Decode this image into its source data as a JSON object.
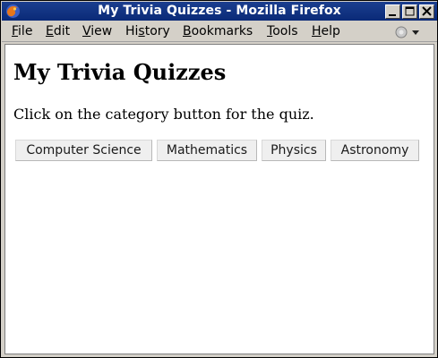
{
  "window": {
    "title": "My Trivia Quizzes - Mozilla Firefox"
  },
  "menubar": {
    "items": [
      {
        "label_pre": "",
        "label_u": "F",
        "label_post": "ile"
      },
      {
        "label_pre": "",
        "label_u": "E",
        "label_post": "dit"
      },
      {
        "label_pre": "",
        "label_u": "V",
        "label_post": "iew"
      },
      {
        "label_pre": "Hi",
        "label_u": "s",
        "label_post": "tory"
      },
      {
        "label_pre": "",
        "label_u": "B",
        "label_post": "ookmarks"
      },
      {
        "label_pre": "",
        "label_u": "T",
        "label_post": "ools"
      },
      {
        "label_pre": "",
        "label_u": "H",
        "label_post": "elp"
      }
    ]
  },
  "page": {
    "heading": "My Trivia Quizzes",
    "description": "Click on the category button for the quiz.",
    "categories": [
      {
        "label": "Computer Science"
      },
      {
        "label": "Mathematics"
      },
      {
        "label": "Physics"
      },
      {
        "label": "Astronomy"
      }
    ]
  },
  "icons": {
    "app": "firefox-icon",
    "minimize": "minimize-icon",
    "maximize": "maximize-icon",
    "close": "close-icon",
    "activity": "throbber-icon"
  }
}
